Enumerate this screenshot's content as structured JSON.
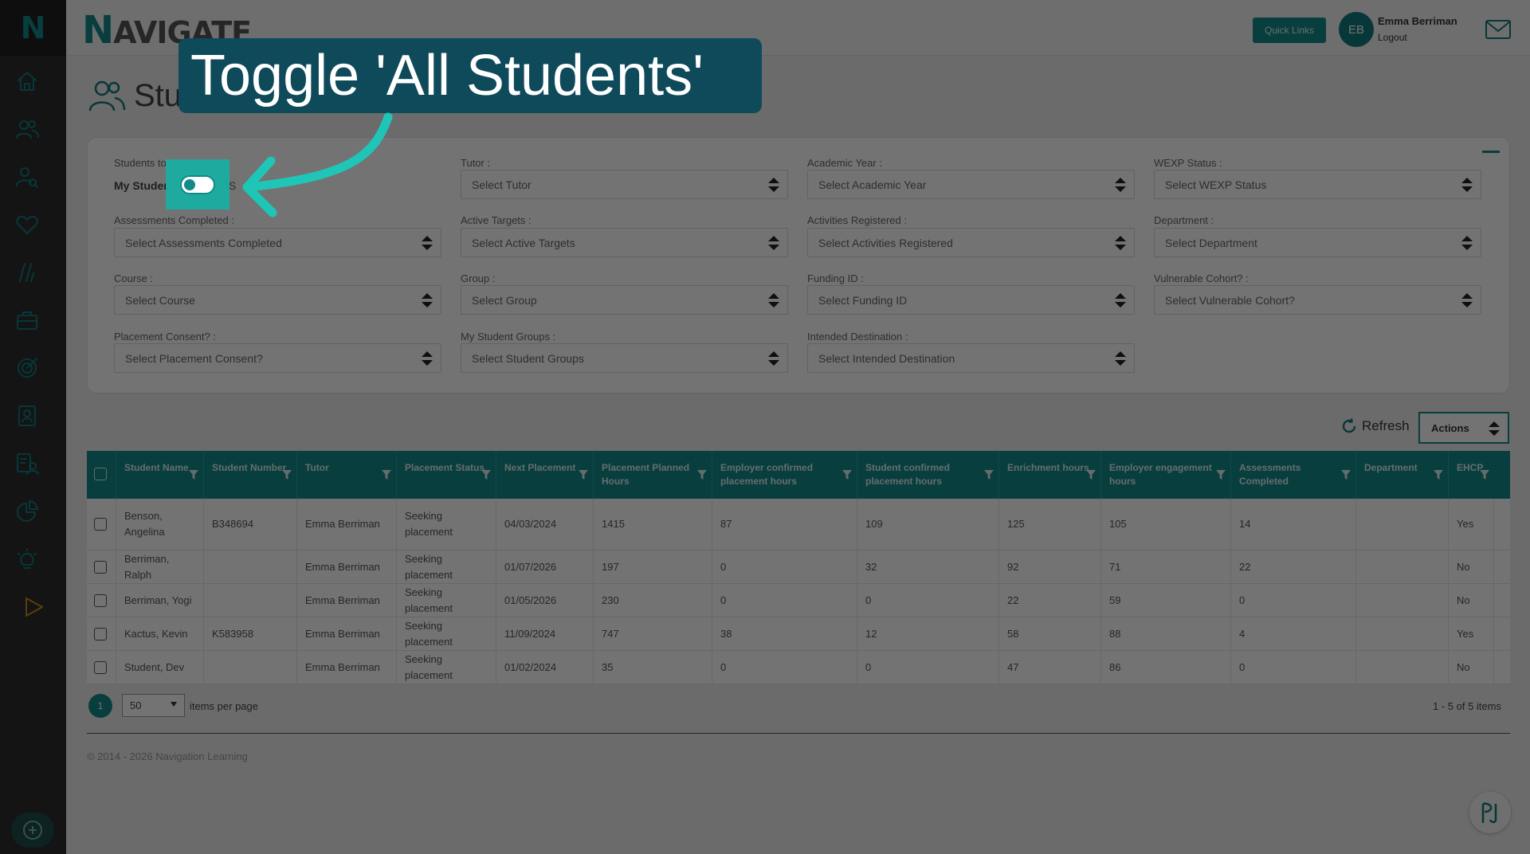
{
  "app": {
    "logo_letter": "N",
    "brand_first": "N",
    "brand_rest": "AVIGATE"
  },
  "header": {
    "quick_links": "Quick Links",
    "user_initials": "EB",
    "user_name": "Emma Berriman",
    "logout": "Logout"
  },
  "page": {
    "title": "Stu"
  },
  "filters": {
    "students_label": "Students to V",
    "my_students": "My Studen",
    "all_students": "l S",
    "tutor": {
      "label": "Tutor :",
      "placeholder": "Select Tutor"
    },
    "academic_year": {
      "label": "Academic Year :",
      "placeholder": "Select Academic Year"
    },
    "wexp_status": {
      "label": "WEXP Status :",
      "placeholder": "Select WEXP Status"
    },
    "assessments_completed": {
      "label": "Assessments Completed :",
      "placeholder": "Select Assessments Completed"
    },
    "active_targets": {
      "label": "Active Targets :",
      "placeholder": "Select Active Targets"
    },
    "activities_registered": {
      "label": "Activities Registered :",
      "placeholder": "Select Activities Registered"
    },
    "department": {
      "label": "Department :",
      "placeholder": "Select Department"
    },
    "course": {
      "label": "Course :",
      "placeholder": "Select Course"
    },
    "group": {
      "label": "Group :",
      "placeholder": "Select Group"
    },
    "funding_id": {
      "label": "Funding ID :",
      "placeholder": "Select Funding ID"
    },
    "vulnerable_cohort": {
      "label": "Vulnerable Cohort? :",
      "placeholder": "Select Vulnerable Cohort?"
    },
    "placement_consent": {
      "label": "Placement Consent? :",
      "placeholder": "Select Placement Consent?"
    },
    "student_groups": {
      "label": "My Student Groups :",
      "placeholder": "Select Student Groups"
    },
    "intended_destination": {
      "label": "Intended Destination :",
      "placeholder": "Select Intended Destination"
    }
  },
  "toolbar": {
    "refresh": "Refresh",
    "actions": "Actions"
  },
  "table": {
    "columns": [
      "Student Name",
      "Student Number",
      "Tutor",
      "Placement Status",
      "Next Placement",
      "Placement Planned Hours",
      "Employer confirmed placement hours",
      "Student confirmed placement hours",
      "Enrichment hours",
      "Employer engagement hours",
      "Assessments Completed",
      "Department",
      "EHCP"
    ],
    "rows": [
      [
        "Benson, Angelina",
        "B348694",
        "Emma Berriman",
        "Seeking placement",
        "04/03/2024",
        "1415",
        "87",
        "109",
        "125",
        "105",
        "14",
        "",
        "Yes"
      ],
      [
        "Berriman, Ralph",
        "",
        "Emma Berriman",
        "Seeking placement",
        "01/07/2026",
        "197",
        "0",
        "32",
        "92",
        "71",
        "22",
        "",
        "No"
      ],
      [
        "Berriman, Yogi",
        "",
        "Emma Berriman",
        "Seeking placement",
        "01/05/2026",
        "230",
        "0",
        "0",
        "22",
        "59",
        "0",
        "",
        "No"
      ],
      [
        "Kactus, Kevin",
        "K583958",
        "Emma Berriman",
        "Seeking placement",
        "11/09/2024",
        "747",
        "38",
        "12",
        "58",
        "88",
        "4",
        "",
        "Yes"
      ],
      [
        "Student, Dev",
        "",
        "Emma Berriman",
        "Seeking placement",
        "01/02/2024",
        "35",
        "0",
        "0",
        "47",
        "86",
        "0",
        "",
        "No"
      ]
    ]
  },
  "pager": {
    "page": "1",
    "per_page": "50",
    "per_page_label": "items per page",
    "summary": "1 - 5 of 5 items"
  },
  "footer": {
    "copyright": "© 2014 - 2026 Navigation Learning"
  },
  "overlay": {
    "callout": "Toggle 'All Students'"
  },
  "colors": {
    "accent": "#138a8a",
    "callout_bg": "#0f4a5a",
    "arrow": "#1fc6b8"
  }
}
